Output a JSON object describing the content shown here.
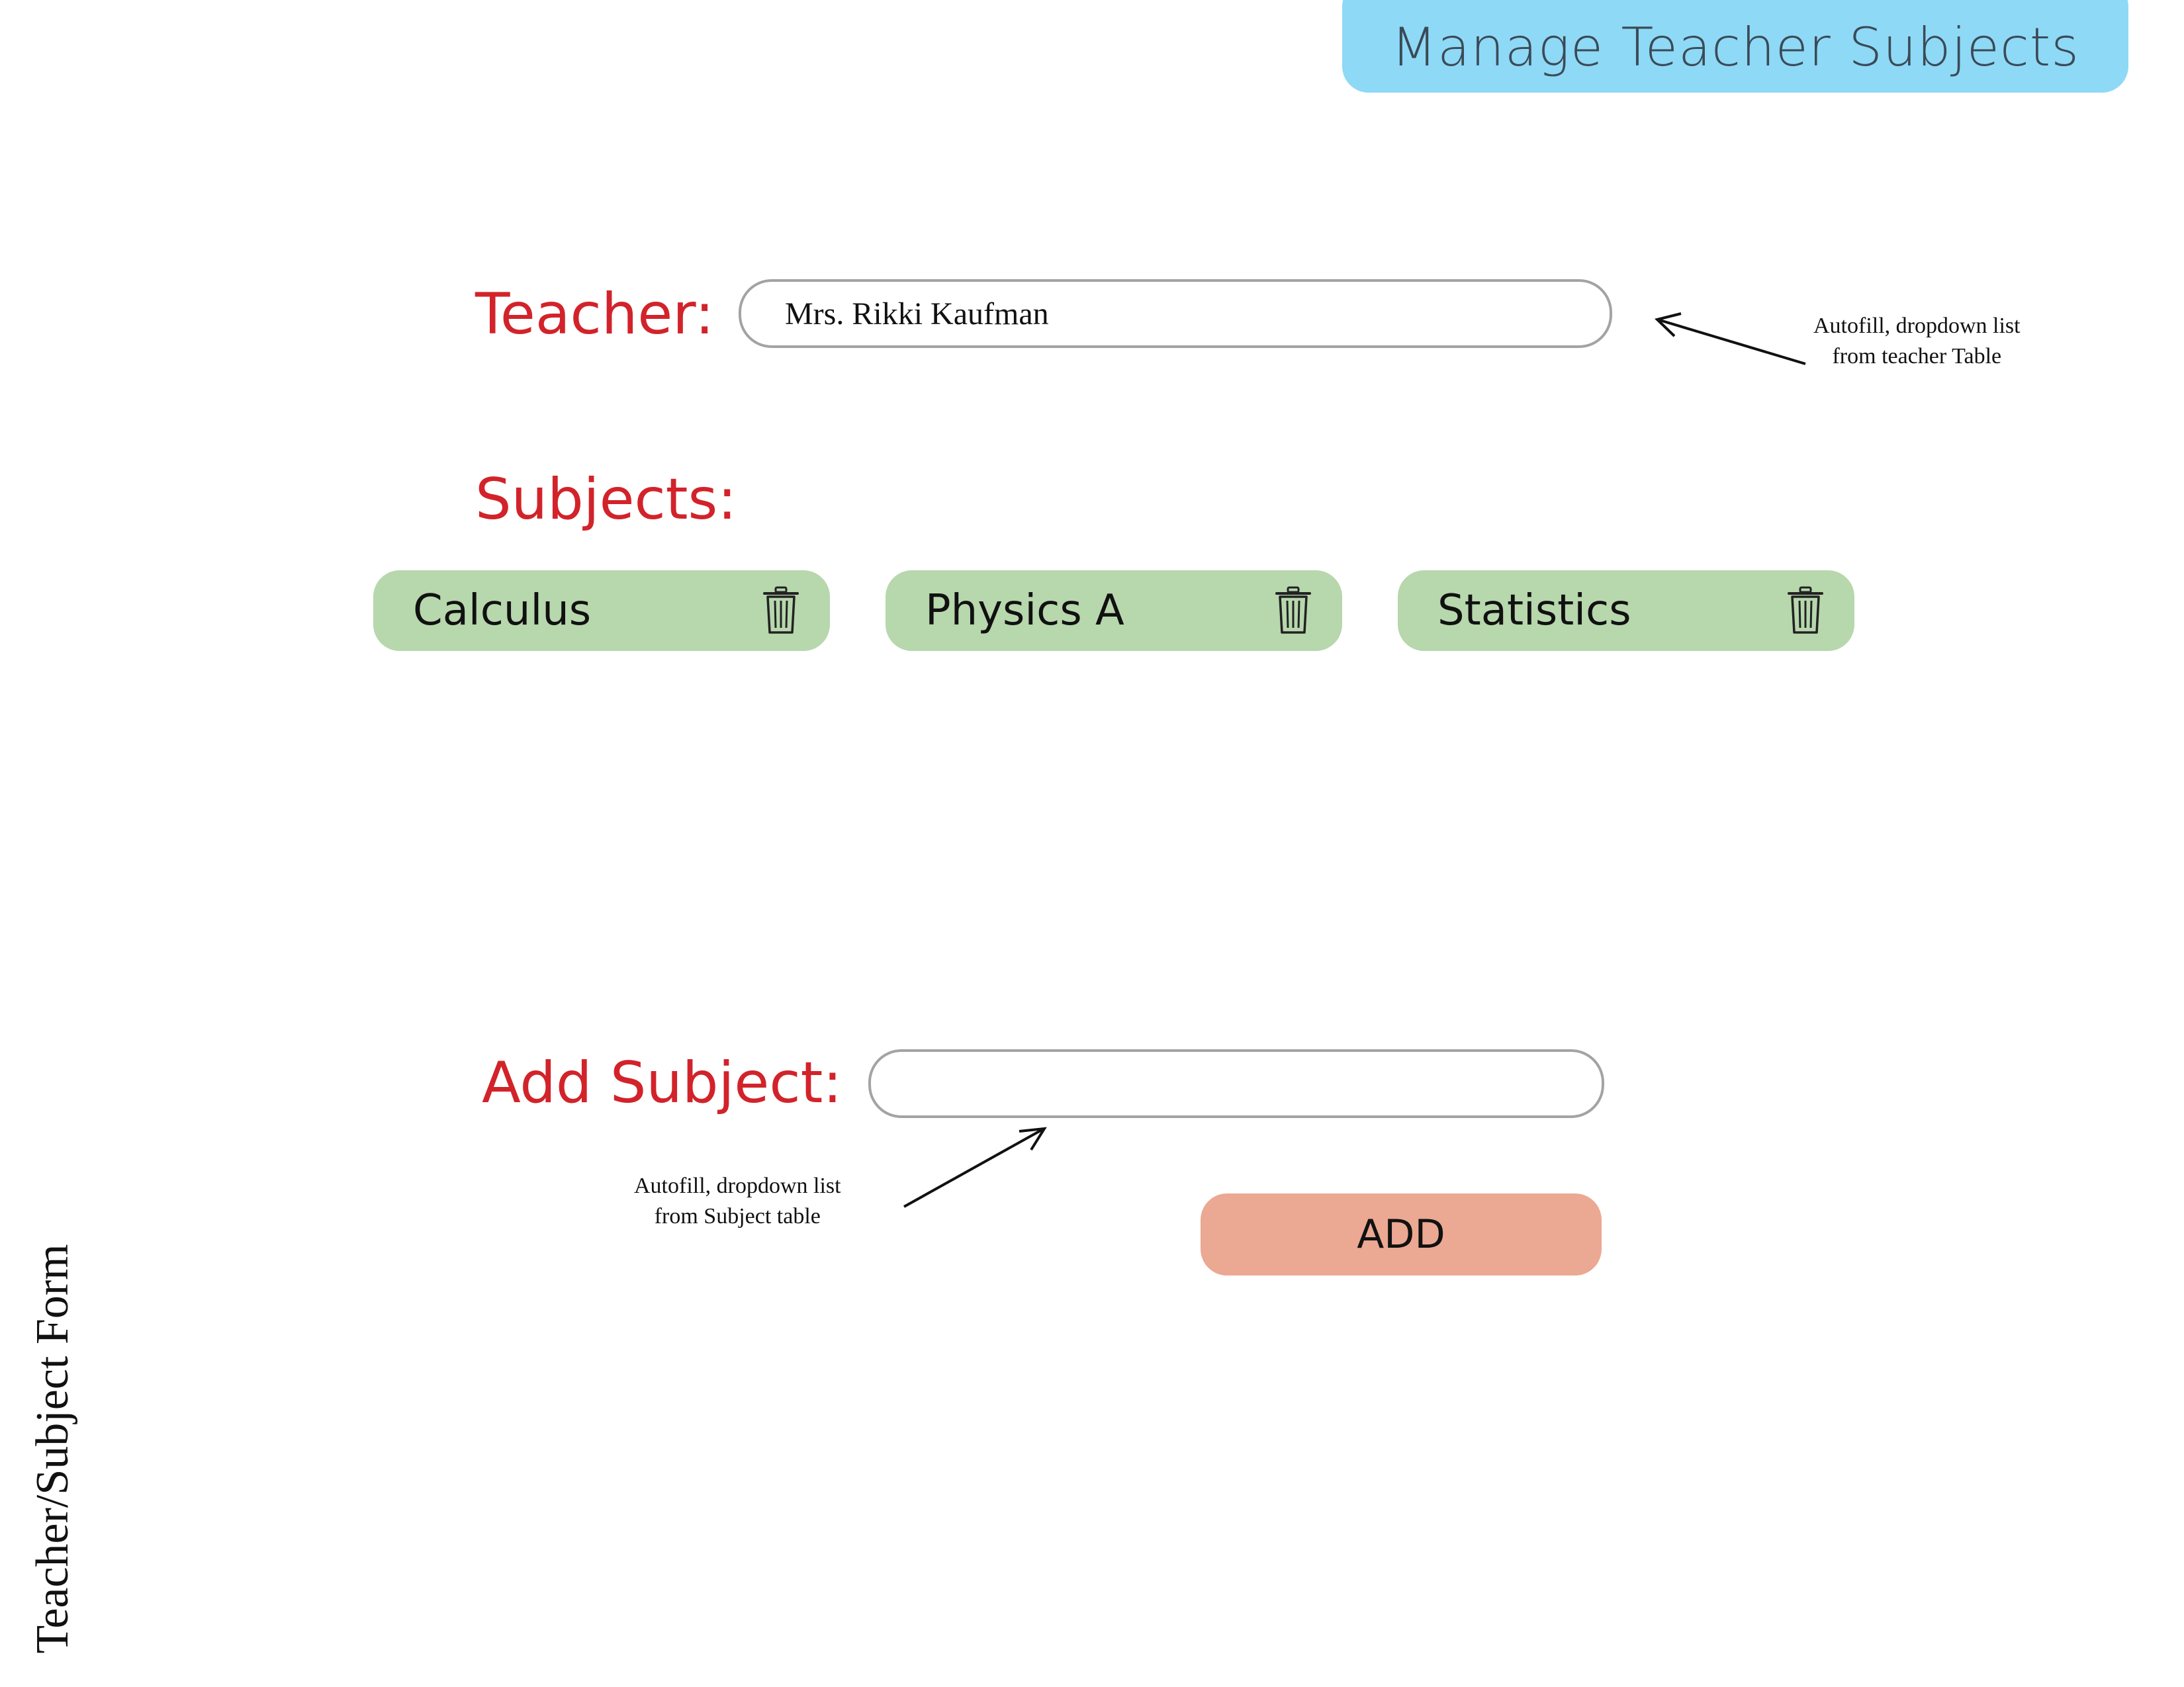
{
  "header": {
    "title": "Manage Teacher Subjects"
  },
  "teacher": {
    "label": "Teacher:",
    "value": "Mrs. Rikki Kaufman"
  },
  "subjects": {
    "label": "Subjects:",
    "items": [
      {
        "label": "Calculus"
      },
      {
        "label": "Physics A"
      },
      {
        "label": "Statistics"
      }
    ]
  },
  "add_subject": {
    "label": "Add Subject:",
    "value": "",
    "button_label": "ADD"
  },
  "annotations": {
    "teacher_note_line1": "Autofill, dropdown list",
    "teacher_note_line2": "from teacher Table",
    "subject_note_line1": "Autofill, dropdown list",
    "subject_note_line2": "from Subject table"
  },
  "side_title": "Teacher/Subject Form",
  "colors": {
    "header_bg": "#8ed9f6",
    "label_red": "#d2232a",
    "chip_green": "#b7d7ad",
    "button_salmon": "#eba892",
    "field_border": "#a3a3a3"
  },
  "icons": {
    "chip_action": "trash-icon",
    "annotation_pointer": "arrow-icon"
  }
}
